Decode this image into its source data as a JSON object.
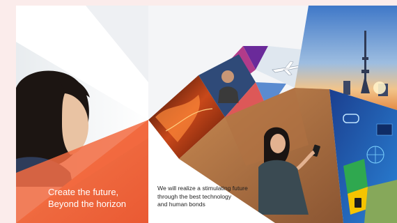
{
  "hero": {
    "headline_line1": "Create the future,",
    "headline_line2": "Beyond the horizon",
    "mission_line1": "We will realize a stimulating future",
    "mission_line2": "through the best technology",
    "mission_line3": "and human bonds"
  },
  "colors": {
    "page_background": "#fbeceb",
    "accent_orange": "#f0673f",
    "sky_blue": "#5b8fd0",
    "city_night": "#1a2a6b",
    "white": "#ffffff"
  },
  "icons": [
    "airplane-icon",
    "sky-tower-icon",
    "car-icon",
    "smartphone-icon",
    "globe-network-icon"
  ]
}
